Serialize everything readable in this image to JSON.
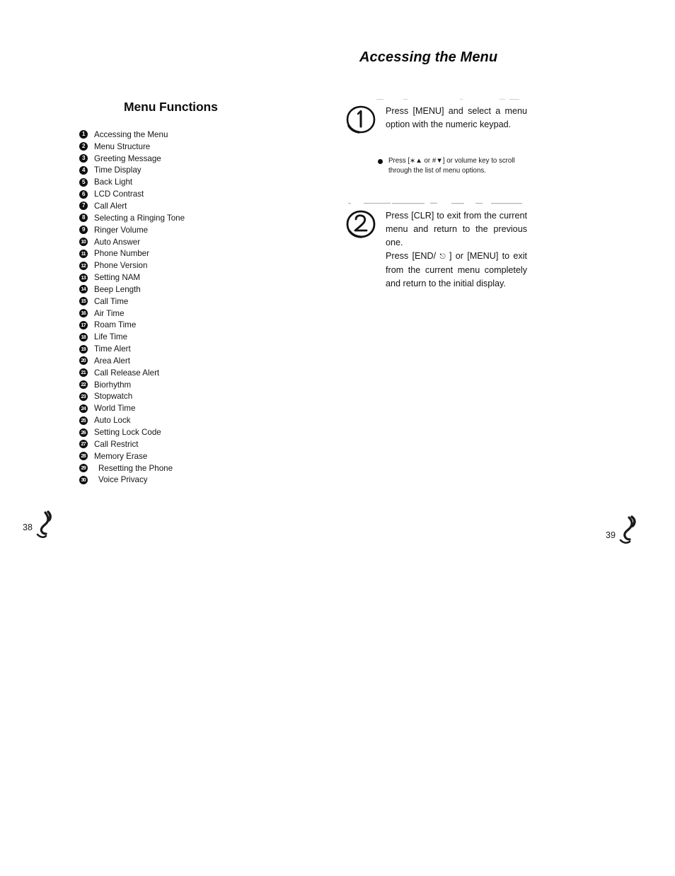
{
  "document": {
    "chapter_title": "Accessing the Menu"
  },
  "left_page": {
    "heading": "Menu Functions",
    "page_number": "38",
    "items": [
      {
        "num": "1",
        "label": "Accessing the Menu"
      },
      {
        "num": "2",
        "label": "Menu Structure"
      },
      {
        "num": "3",
        "label": "Greeting Message"
      },
      {
        "num": "4",
        "label": "Time Display"
      },
      {
        "num": "5",
        "label": "Back Light"
      },
      {
        "num": "6",
        "label": "LCD Contrast"
      },
      {
        "num": "7",
        "label": "Call Alert"
      },
      {
        "num": "8",
        "label": "Selecting a Ringing Tone"
      },
      {
        "num": "9",
        "label": "Ringer Volume"
      },
      {
        "num": "10",
        "label": "Auto Answer"
      },
      {
        "num": "11",
        "label": "Phone Number"
      },
      {
        "num": "12",
        "label": "Phone Version"
      },
      {
        "num": "13",
        "label": "Setting NAM"
      },
      {
        "num": "14",
        "label": "Beep Length"
      },
      {
        "num": "15",
        "label": "Call Time"
      },
      {
        "num": "16",
        "label": "Air Time"
      },
      {
        "num": "17",
        "label": "Roam Time"
      },
      {
        "num": "18",
        "label": "Life Time"
      },
      {
        "num": "19",
        "label": "Time Alert"
      },
      {
        "num": "20",
        "label": "Area Alert"
      },
      {
        "num": "21",
        "label": "Call Release Alert"
      },
      {
        "num": "22",
        "label": "Biorhythm"
      },
      {
        "num": "23",
        "label": "Stopwatch"
      },
      {
        "num": "24",
        "label": "World Time"
      },
      {
        "num": "25",
        "label": "Auto Lock"
      },
      {
        "num": "26",
        "label": "Setting Lock Code"
      },
      {
        "num": "27",
        "label": "Call Restrict"
      },
      {
        "num": "28",
        "label": "Memory Erase"
      },
      {
        "num": "29",
        "label": "Resetting the Phone",
        "indented": true
      },
      {
        "num": "30",
        "label": "Voice Privacy",
        "indented": true
      }
    ]
  },
  "right_page": {
    "page_number": "39",
    "steps": [
      {
        "number": "1",
        "text": "Press [MENU] and select a menu option with the numeric keypad.",
        "note": "Press [∗▲ or #▼] or volume key to scroll through the list of menu options."
      },
      {
        "number": "2",
        "paragraph_1": "Press [CLR] to exit from the current menu and return to the previous one.",
        "paragraph_2_a": "Press [END/ ",
        "paragraph_2_icon": "power-symbol",
        "paragraph_2_b": " ] or [MENU] to exit from the current menu completely and return to the initial display."
      }
    ]
  }
}
